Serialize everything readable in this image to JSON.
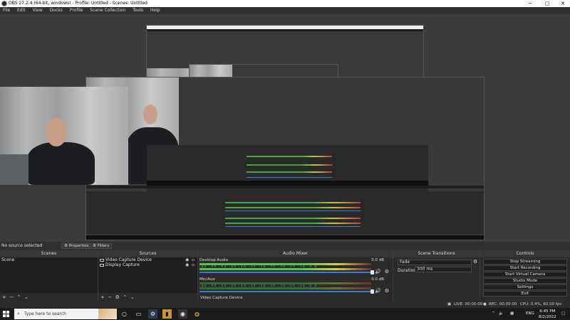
{
  "window": {
    "title": "OBS 27.2.4 (64-bit, windows) - Profile: Untitled - Scenes: Untitled",
    "minimize": "─",
    "maximize": "▢",
    "close": "✕"
  },
  "menu": [
    "File",
    "Edit",
    "View",
    "Docks",
    "Profile",
    "Scene Collection",
    "Tools",
    "Help"
  ],
  "dockstrip": {
    "no_source": "No source selected",
    "properties": "Properties",
    "filters": "Filters"
  },
  "scenes": {
    "title": "Scenes",
    "items": [
      "Scene"
    ]
  },
  "sources": {
    "title": "Sources",
    "items": [
      "Video Capture Device",
      "Display Capture"
    ]
  },
  "mixer": {
    "title": "Audio Mixer",
    "tracks": [
      {
        "name": "Desktop Audio",
        "db": "0.0 dB",
        "level": 0.86
      },
      {
        "name": "Mic/Aux",
        "db": "0.0 dB",
        "level": 0.86
      }
    ],
    "ticks": "-60 -55 -50 -45 -40 -35 -30 -25 -20 -15 -10 -5 0",
    "extra": "Video Capture Device"
  },
  "transitions": {
    "title": "Scene Transitions",
    "selected": "Fade",
    "duration_label": "Duration",
    "duration_value": "300 ms"
  },
  "controls": {
    "title": "Controls",
    "buttons": [
      "Stop Streaming",
      "Start Recording",
      "Start Virtual Camera",
      "Studio Mode",
      "Settings",
      "Exit"
    ]
  },
  "footer_buttons": {
    "add": "+",
    "remove": "−",
    "gear": "⚙",
    "up": "⌃",
    "down": "⌄"
  },
  "status": {
    "live": "LIVE: 00:00:00",
    "rec": "REC: 00:00:00",
    "cpu": "CPU: 0.4%, 60.00 fps"
  },
  "taskbar": {
    "search_placeholder": "Type here to search",
    "time": "6:45 PM",
    "date": "8/2/2022",
    "lang": "ENG"
  },
  "colors": {
    "meter_green": "#4cc94c",
    "meter_yellow": "#d4d44c",
    "meter_red": "#c94c4c",
    "slider_blue": "#3a7fd6"
  }
}
